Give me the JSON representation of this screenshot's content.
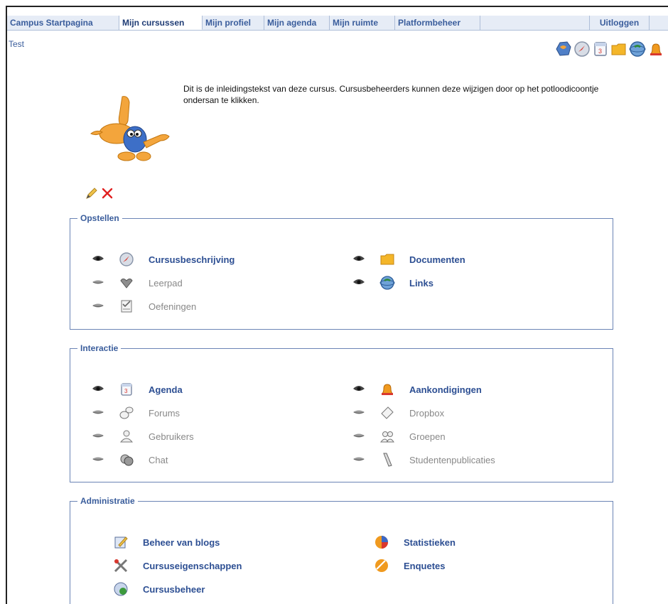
{
  "tabs": [
    {
      "label": "Campus Startpagina",
      "active": false
    },
    {
      "label": "Mijn cursussen",
      "active": true
    },
    {
      "label": "Mijn profiel",
      "active": false
    },
    {
      "label": "Mijn agenda",
      "active": false
    },
    {
      "label": "Mijn ruimte",
      "active": false
    },
    {
      "label": "Platformbeheer",
      "active": false
    }
  ],
  "logout_label": "Uitloggen",
  "course_title": "Test",
  "intro_text": "Dit is de inleidingstekst van deze cursus. Cursusbeheerders kunnen deze wijzigen door op het potloodicoontje ondersan te klikken.",
  "toolbar_icons": [
    "globe-icon",
    "compass-icon",
    "calendar-icon",
    "folder-icon",
    "links-icon",
    "bell-icon"
  ],
  "sections": {
    "opstellen": {
      "title": "Opstellen",
      "tools": [
        {
          "label": "Cursusbeschrijving",
          "icon": "compass-icon",
          "visible": true
        },
        {
          "label": "Leerpad",
          "icon": "path-icon",
          "visible": false
        },
        {
          "label": "Oefeningen",
          "icon": "exercises-icon",
          "visible": false
        },
        {
          "label": "Documenten",
          "icon": "folder-icon",
          "visible": true
        },
        {
          "label": "Links",
          "icon": "links-icon",
          "visible": true
        }
      ]
    },
    "interactie": {
      "title": "Interactie",
      "tools": [
        {
          "label": "Agenda",
          "icon": "calendar-icon",
          "visible": true
        },
        {
          "label": "Forums",
          "icon": "forums-icon",
          "visible": false
        },
        {
          "label": "Gebruikers",
          "icon": "users-icon",
          "visible": false
        },
        {
          "label": "Chat",
          "icon": "chat-icon",
          "visible": false
        },
        {
          "label": "Aankondigingen",
          "icon": "bell-icon",
          "visible": true
        },
        {
          "label": "Dropbox",
          "icon": "dropbox-icon",
          "visible": false
        },
        {
          "label": "Groepen",
          "icon": "groups-icon",
          "visible": false
        },
        {
          "label": "Studentenpublicaties",
          "icon": "publications-icon",
          "visible": false
        }
      ]
    },
    "administratie": {
      "title": "Administratie",
      "tools": [
        {
          "label": "Beheer van blogs",
          "icon": "blog-icon"
        },
        {
          "label": "Cursuseigenschappen",
          "icon": "settings-icon"
        },
        {
          "label": "Cursusbeheer",
          "icon": "course-admin-icon"
        },
        {
          "label": "Statistieken",
          "icon": "statistics-icon"
        },
        {
          "label": "Enquetes",
          "icon": "survey-icon"
        }
      ]
    }
  },
  "colors": {
    "link": "#2d4f93",
    "inactive": "#888888",
    "border": "#6b84b5",
    "tab_bg": "#e6ecf6"
  }
}
